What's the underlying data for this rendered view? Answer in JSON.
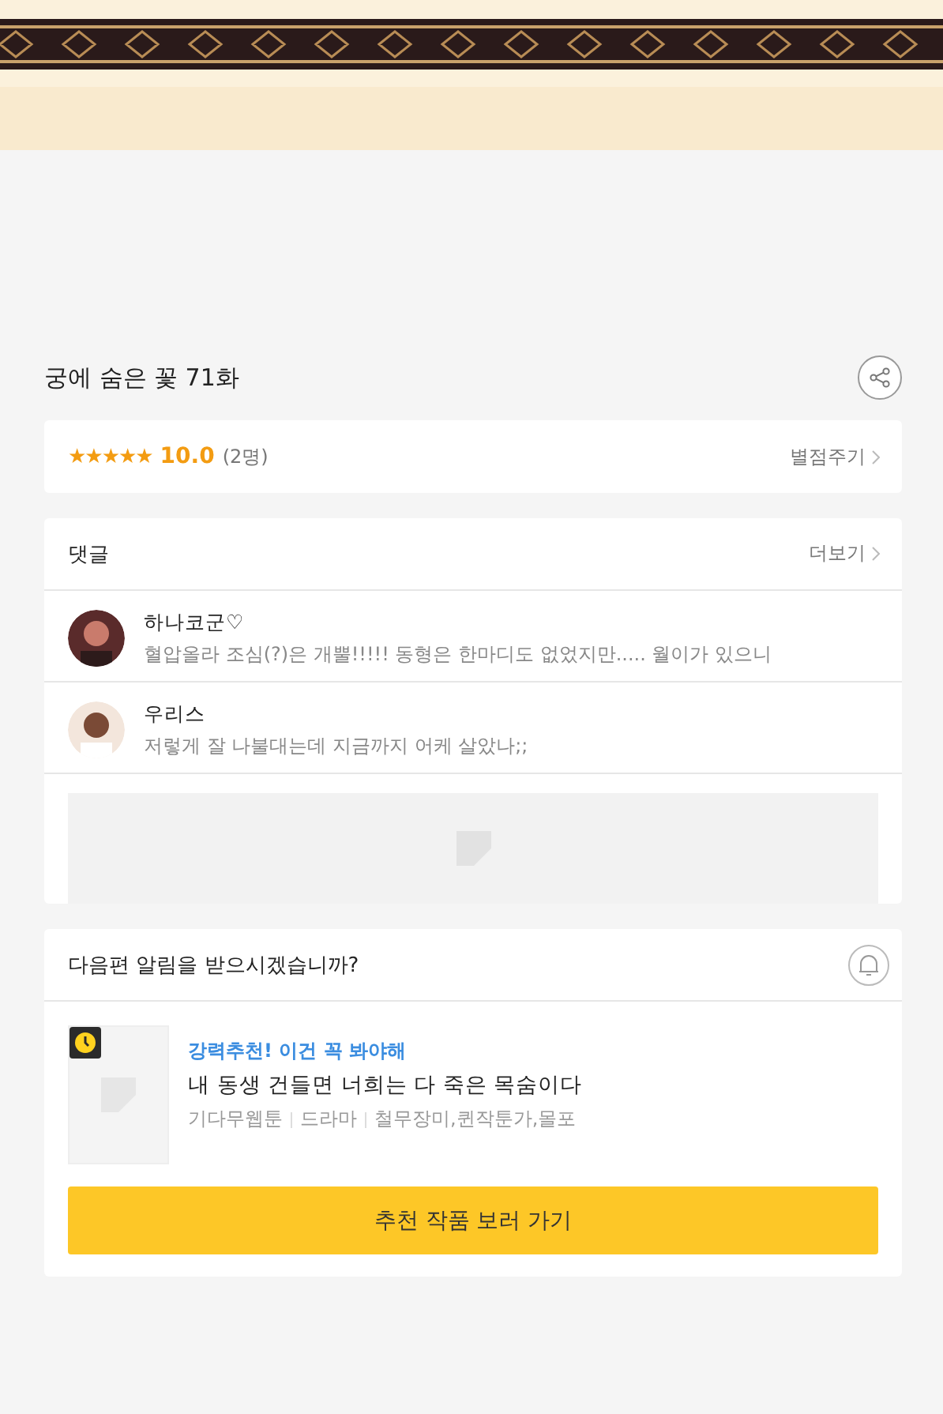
{
  "episode": {
    "title": "궁에 숨은 꽃 71화"
  },
  "rating": {
    "stars": 5,
    "score": "10.0",
    "count": "(2명)",
    "action": "별점주기"
  },
  "comments": {
    "title": "댓글",
    "more": "더보기",
    "items": [
      {
        "author": "하나코군♡",
        "text": "혈압올라 조심(?)은 개뿔!!!!! 동형은 한마디도 없었지만..... 월이가 있으니"
      },
      {
        "author": "우리스",
        "text": "저렇게 잘 나불대는데 지금까지 어케 살았나;;"
      }
    ]
  },
  "notify": {
    "question": "다음편 알림을 받으시겠습니까?"
  },
  "recommend": {
    "tag": "강력추천! 이건 꼭 봐야해",
    "title": "내 동생 건들면 너희는 다 죽은 목숨이다",
    "meta": [
      "기다무웹툰",
      "드라마",
      "철무장미,퀸작툰가,몰포"
    ],
    "button": "추천 작품 보러 가기"
  }
}
